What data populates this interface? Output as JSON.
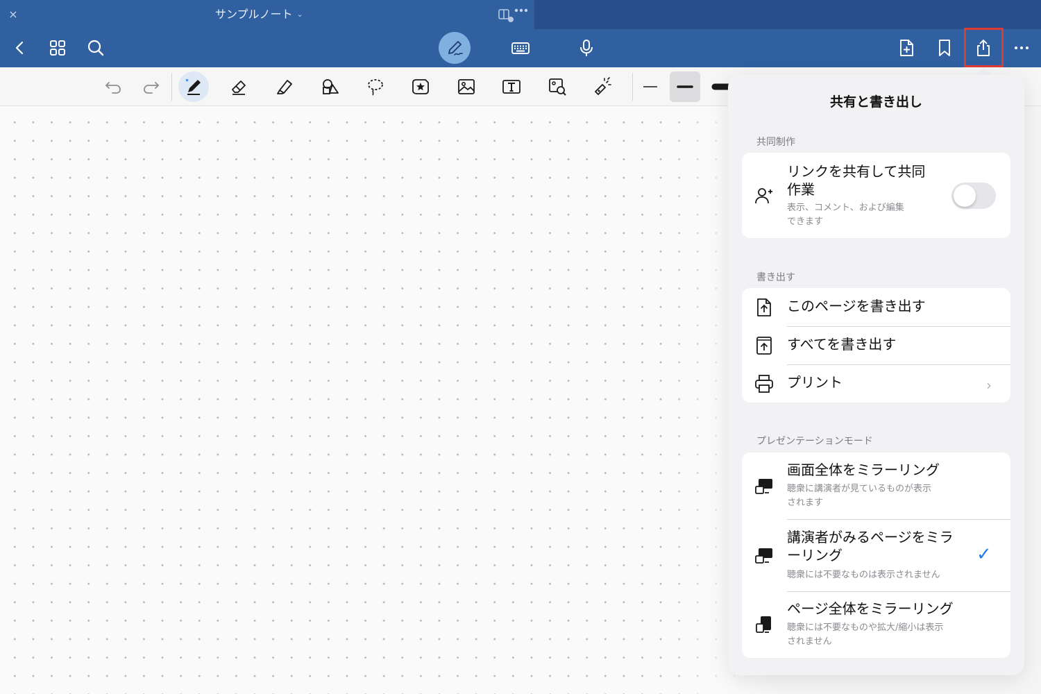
{
  "window": {
    "close_glyph": "×",
    "note_title": "サンプルノート",
    "title_chevron": "⌄"
  },
  "toolbar": {
    "left_icons": [
      "back-chevron-icon",
      "grid-view-icon",
      "search-icon"
    ],
    "center_icons": [
      "pen-mode-icon",
      "keyboard-icon",
      "microphone-icon"
    ],
    "right_icons": [
      "add-page-icon",
      "bookmark-icon",
      "export-share-icon",
      "more-icon"
    ],
    "export_highlight_color": "#e03a33"
  },
  "tools": {
    "items": [
      "undo-icon",
      "redo-icon",
      "pen-icon",
      "eraser-icon",
      "highlighter-icon",
      "shapes-icon",
      "lasso-icon",
      "sticker-icon",
      "image-icon",
      "text-box-icon",
      "image-search-icon",
      "laser-pointer-icon"
    ],
    "stroke_widths": [
      "thin",
      "medium",
      "thick"
    ]
  },
  "popover": {
    "title": "共有と書き出し",
    "collab": {
      "section": "共同制作",
      "share_title_line1": "リンクを共有して共同",
      "share_title_line2": "作業",
      "share_sub_line1": "表示、コメント、および編集",
      "share_sub_line2": "できます",
      "toggle_on": false
    },
    "export": {
      "section": "書き出す",
      "this_page": "このページを書き出す",
      "all": "すべてを書き出す",
      "print": "プリント",
      "chevron": "›"
    },
    "presentation": {
      "section": "プレゼンテーションモード",
      "mirror_all_title": "画面全体をミラーリング",
      "mirror_all_sub_line1": "聴衆に講演者が見ているものが表示",
      "mirror_all_sub_line2": "されます",
      "presenter_title_line1": "講演者がみるページをミラ",
      "presenter_title_line2": "ーリング",
      "presenter_sub": "聴衆には不要なものは表示されません",
      "presenter_check": "✓",
      "page_all_title": "ページ全体をミラーリング",
      "page_all_sub_line1": "聴衆には不要なものや拡大/縮小は表示",
      "page_all_sub_line2": "されません"
    }
  },
  "colors": {
    "titlebar": "#30609f",
    "accent_blue": "#1e7cf2"
  }
}
